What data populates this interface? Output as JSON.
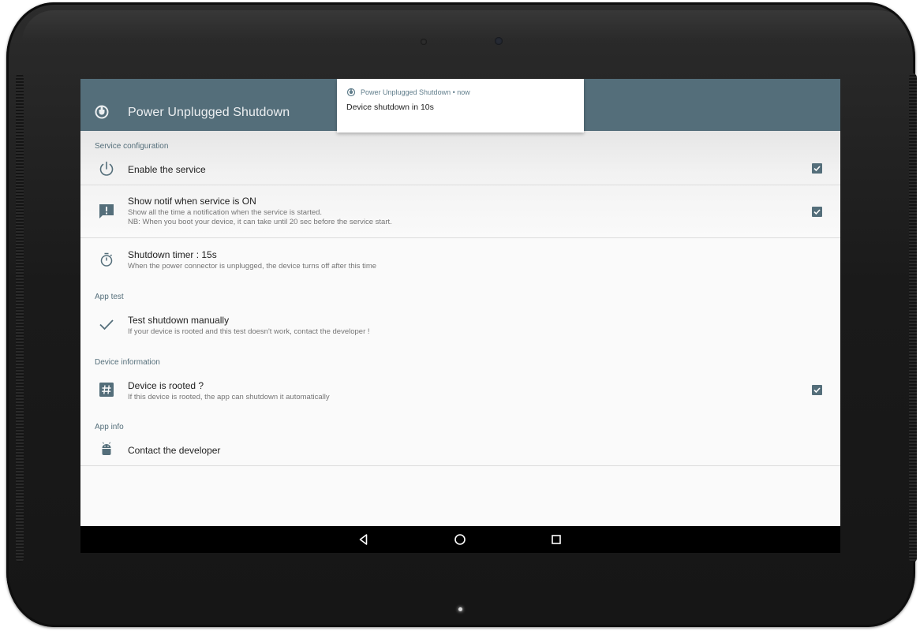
{
  "app": {
    "title": "Power Unplugged Shutdown"
  },
  "notification": {
    "app_name": "Power Unplugged Shutdown",
    "separator": "•",
    "time": "now",
    "text": "Device shutdown in 10s"
  },
  "sections": {
    "service_config": "Service configuration",
    "app_test": "App test",
    "device_info": "Device information",
    "app_info": "App info"
  },
  "prefs": {
    "enable_service": {
      "title": "Enable the service",
      "checked": true,
      "icon": "power-icon"
    },
    "show_notif": {
      "title": "Show notif when service is ON",
      "summary1": "Show all the time a notification when the service is started.",
      "summary2": "NB: When you boot your device, it can take until 20 sec before the service start.",
      "checked": true,
      "icon": "notification-alert-icon"
    },
    "shutdown_timer": {
      "title": "Shutdown timer : 15s",
      "summary": "When the power connector is unplugged, the device turns off after this time",
      "icon": "timer-icon"
    },
    "test_shutdown": {
      "title": "Test shutdown manually",
      "summary": "If your device is rooted and this test doesn't work, contact the developer !",
      "icon": "check-icon"
    },
    "device_rooted": {
      "title": "Device is rooted ?",
      "summary": "If this device is rooted, the app can shutdown it automatically",
      "checked": true,
      "icon": "hash-icon"
    },
    "contact_dev": {
      "title": "Contact the developer",
      "icon": "android-icon"
    }
  },
  "nav": {
    "back": "back-icon",
    "home": "home-icon",
    "recents": "recents-icon"
  },
  "colors": {
    "primary": "#546e7a",
    "accent": "#546e7a",
    "background": "#fafafa"
  }
}
